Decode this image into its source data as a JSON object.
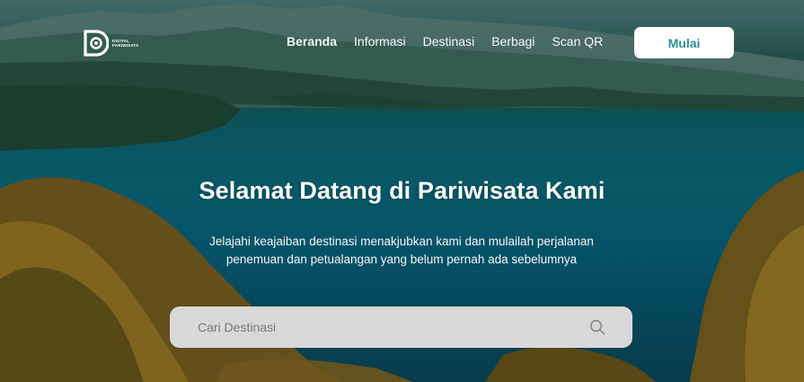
{
  "brand": {
    "name_line1": "DIGITAL",
    "name_line2": "PARIWISATA"
  },
  "nav": {
    "items": [
      {
        "label": "Beranda",
        "active": true
      },
      {
        "label": "Informasi",
        "active": false
      },
      {
        "label": "Destinasi",
        "active": false
      },
      {
        "label": "Berbagi",
        "active": false
      },
      {
        "label": "Scan QR",
        "active": false
      }
    ],
    "cta_label": "Mulai"
  },
  "hero": {
    "title": "Selamat Datang di Pariwisata Kami",
    "subtitle_line1": "Jelajahi keajaiban destinasi menakjubkan kami dan mulailah perjalanan",
    "subtitle_line2": "penemuan dan petualangan yang belum pernah ada sebelumnya"
  },
  "search": {
    "placeholder": "Cari Destinasi",
    "icon": "search-icon"
  },
  "colors": {
    "accent": "#2b8f9a",
    "search_bg": "#d9d9d9",
    "text_light": "#ffffff"
  }
}
